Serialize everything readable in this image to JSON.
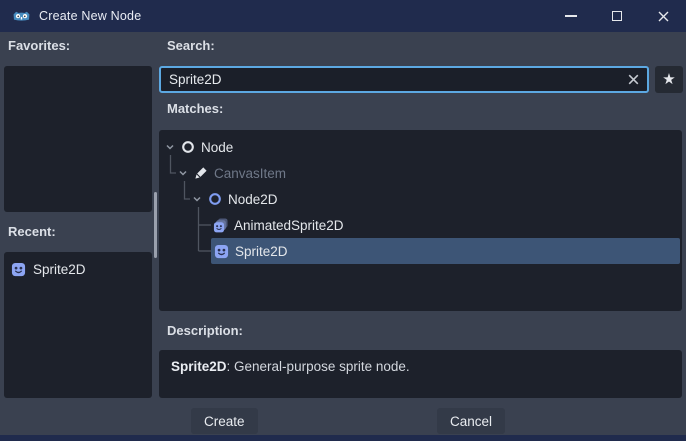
{
  "window": {
    "title": "Create New Node"
  },
  "sidebar": {
    "favorites_label": "Favorites:",
    "recent_label": "Recent:",
    "recent_items": [
      {
        "label": "Sprite2D",
        "icon": "sprite2d-icon"
      }
    ]
  },
  "search": {
    "label": "Search:",
    "value": "Sprite2D",
    "clear_icon": "clear-x-icon",
    "favorite_toggle_icon": "star-icon"
  },
  "matches": {
    "label": "Matches:",
    "tree": [
      {
        "label": "Node",
        "icon": "node-icon",
        "depth": 0,
        "expanded": true,
        "disabled": false,
        "selected": false
      },
      {
        "label": "CanvasItem",
        "icon": "canvas-item-icon",
        "depth": 1,
        "expanded": true,
        "disabled": true,
        "selected": false
      },
      {
        "label": "Node2D",
        "icon": "node2d-icon",
        "depth": 2,
        "expanded": true,
        "disabled": false,
        "selected": false
      },
      {
        "label": "AnimatedSprite2D",
        "icon": "animated-sprite2d-icon",
        "depth": 3,
        "expanded": false,
        "disabled": false,
        "selected": false
      },
      {
        "label": "Sprite2D",
        "icon": "sprite2d-icon",
        "depth": 3,
        "expanded": false,
        "disabled": false,
        "selected": true
      }
    ]
  },
  "description": {
    "label": "Description:",
    "class_name": "Sprite2D",
    "text": ": General-purpose sprite node."
  },
  "footer": {
    "create_label": "Create",
    "cancel_label": "Cancel"
  },
  "icons": {
    "star": "★"
  },
  "colors": {
    "titlebar": "#202b4d",
    "body": "#3a4150",
    "panel": "#1d212b",
    "focus_border": "#5ca8e2",
    "selection": "#3d5576",
    "sprite_icon": "#8da5f3",
    "node2d_icon": "#7f9cf0",
    "disabled_text": "#6f7888"
  }
}
